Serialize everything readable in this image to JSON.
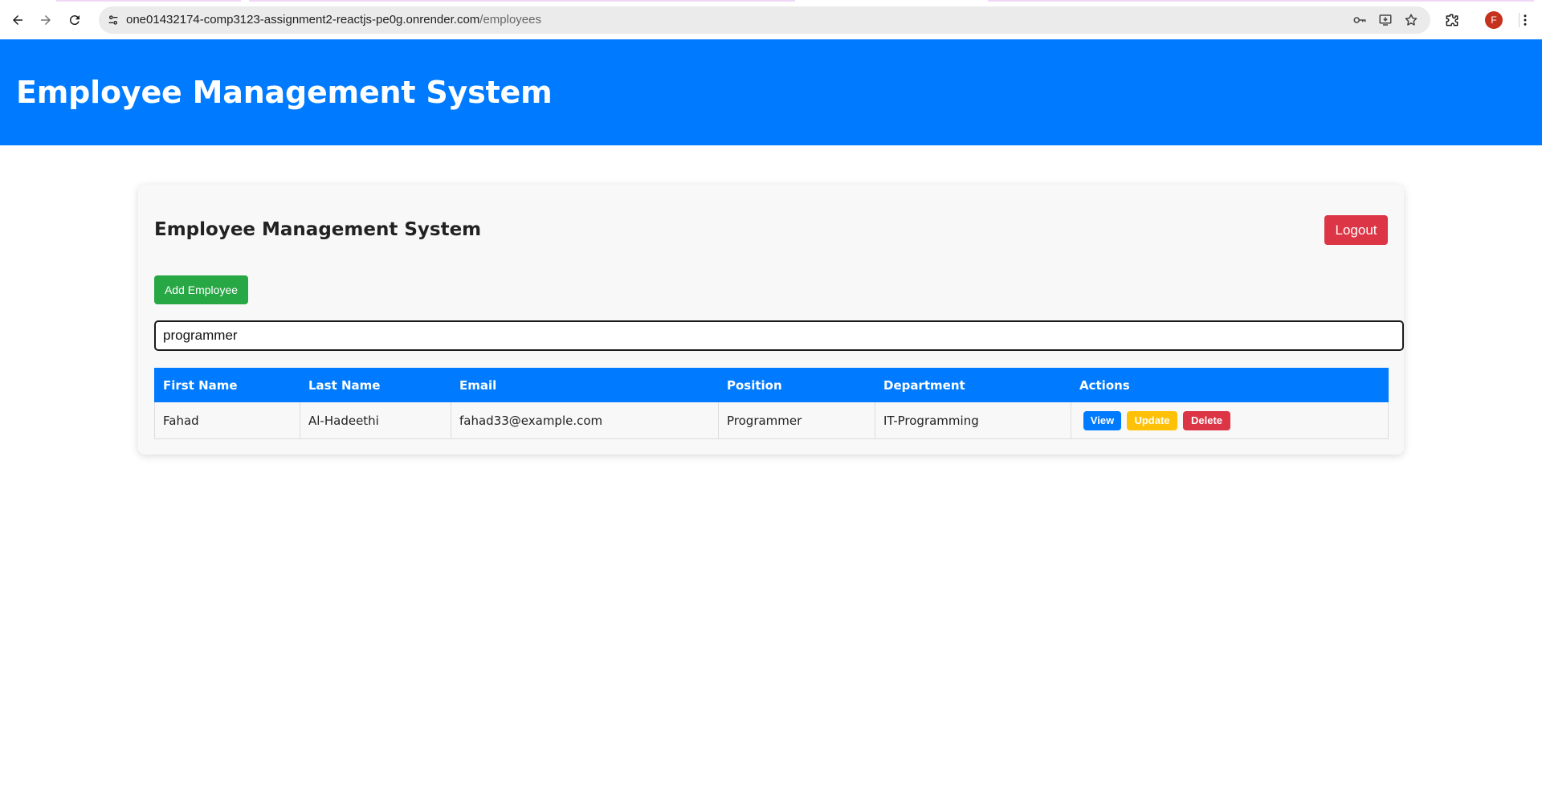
{
  "browser": {
    "url_host": "one01432174-comp3123-assignment2-reactjs-pe0g.onrender.com",
    "url_path": "/employees",
    "profile_initial": "F",
    "icons": [
      "back-icon",
      "forward-icon",
      "reload-icon",
      "site-info-icon",
      "key-icon",
      "install-icon",
      "star-icon",
      "extensions-icon",
      "kebab-menu-icon"
    ]
  },
  "header": {
    "title": "Employee Management System",
    "background": "#007bff"
  },
  "card": {
    "title": "Employee Management System",
    "logout_label": "Logout",
    "add_label": "Add Employee",
    "search_value": "programmer"
  },
  "table": {
    "columns": [
      "First Name",
      "Last Name",
      "Email",
      "Position",
      "Department",
      "Actions"
    ],
    "rows": [
      {
        "first_name": "Fahad",
        "last_name": "Al-Hadeethi",
        "email": "fahad33@example.com",
        "position": "Programmer",
        "department": "IT-Programming",
        "actions": [
          "View",
          "Update",
          "Delete"
        ]
      }
    ]
  },
  "colors": {
    "primary": "#007bff",
    "success": "#28a745",
    "warning": "#ffc107",
    "danger": "#dc3545"
  }
}
